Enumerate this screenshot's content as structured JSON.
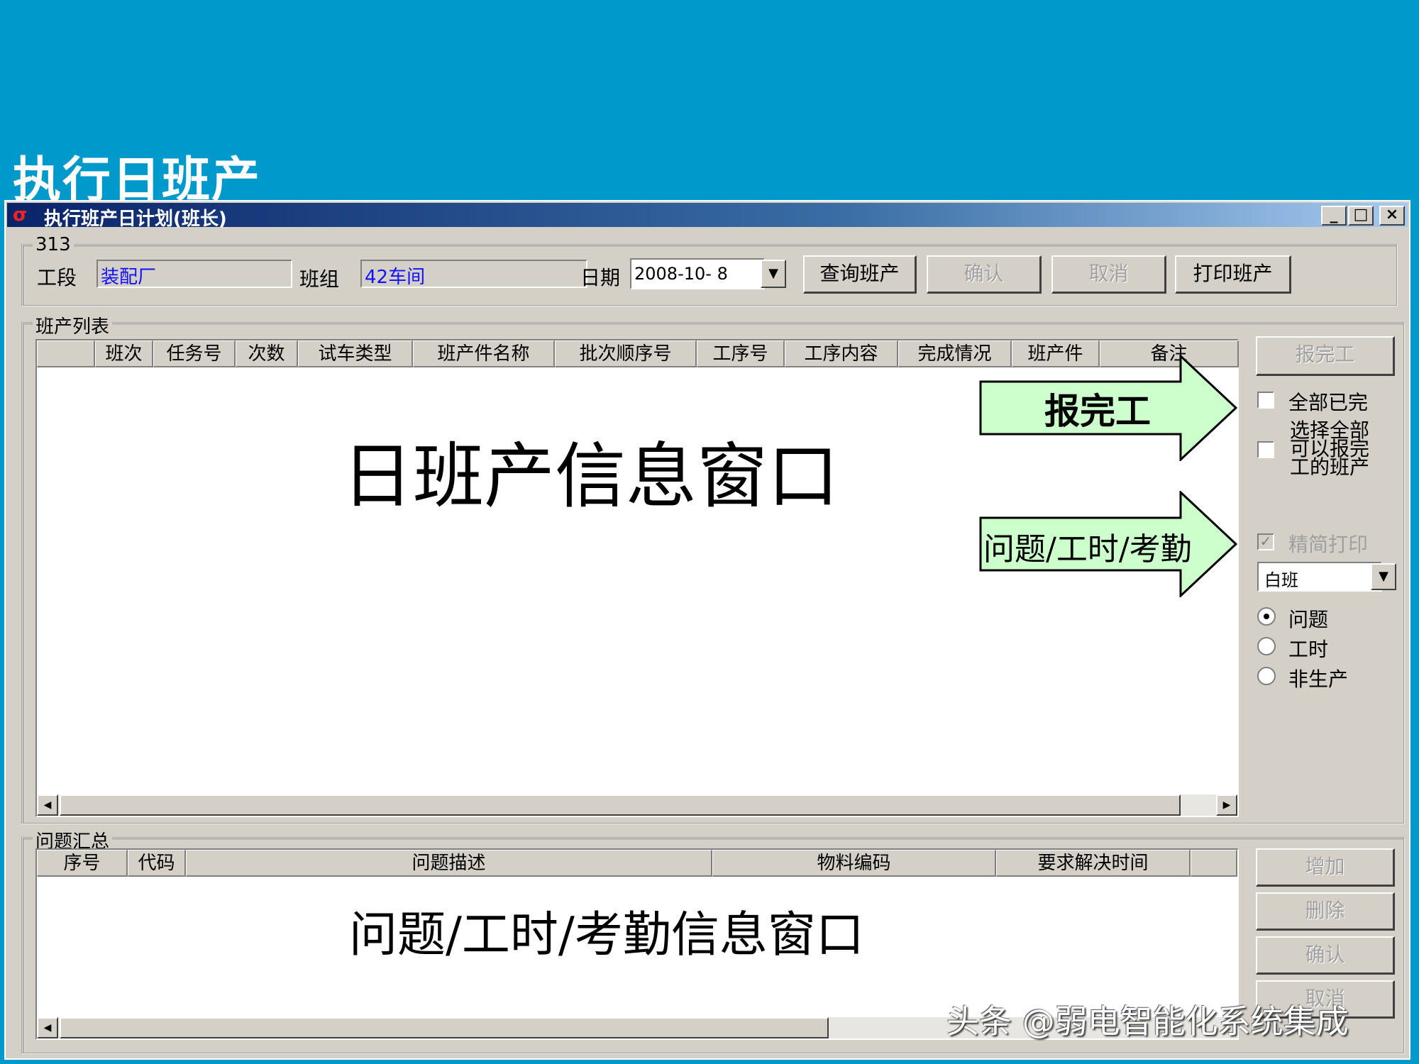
{
  "slide": {
    "title": "执行日班产"
  },
  "window": {
    "title": "执行班产日计划(班长)",
    "controls": {
      "minimize": "_",
      "maximize": "□",
      "close": "×"
    }
  },
  "query_group": {
    "legend": "313",
    "section_label": "工段",
    "section_value": "装配厂",
    "team_label": "班组",
    "team_value": "42车间",
    "date_label": "日期",
    "date_value": "2008-10- 8",
    "buttons": {
      "query": "查询班产",
      "confirm": "确认",
      "cancel": "取消",
      "print": "打印班产"
    }
  },
  "shift_list": {
    "legend": "班产列表",
    "columns": [
      "",
      "班次",
      "任务号",
      "次数",
      "试车类型",
      "班产件名称",
      "批次顺序号",
      "工序号",
      "工序内容",
      "完成情况",
      "班产件",
      "备注"
    ],
    "placeholder": "日班产信息窗口"
  },
  "side_panel": {
    "report_button": "报完工",
    "all_done_label": "全部已完",
    "all_done_checked": false,
    "select_all_label_1": "选择全部",
    "select_all_label_2": "可以报完",
    "select_all_label_3": "工的班产",
    "select_all_checked": false,
    "simple_print_label": "精简打印",
    "simple_print_checked": true,
    "shift_select": "白班",
    "radios": [
      {
        "label": "问题",
        "selected": true
      },
      {
        "label": "工时",
        "selected": false
      },
      {
        "label": "非生产",
        "selected": false
      }
    ]
  },
  "annotations": {
    "arrow_report": "报完工",
    "arrow_issue": "问题/工时/考勤"
  },
  "issue_summary": {
    "legend": "问题汇总",
    "columns": [
      "序号",
      "代码",
      "问题描述",
      "物料编码",
      "要求解决时间",
      ""
    ],
    "placeholder": "问题/工时/考勤信息窗口",
    "buttons": {
      "add": "增加",
      "delete": "删除",
      "confirm": "确认",
      "cancel": "取消"
    }
  },
  "watermark": "头条 @弱电智能化系统集成",
  "colors": {
    "slide_bg": "#0099cc",
    "window_bg": "#d4d0c8",
    "arrow_fill": "#ccffcc",
    "field_text": "#1010ff"
  }
}
